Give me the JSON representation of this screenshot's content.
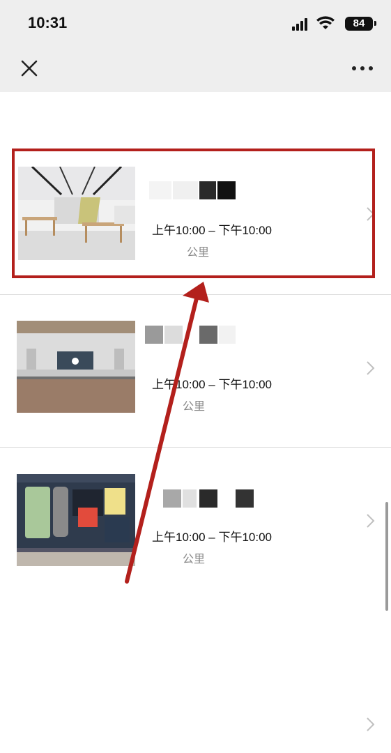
{
  "status_bar": {
    "time": "10:31",
    "battery": "84"
  },
  "nav": {
    "close_icon": "close-icon",
    "more_icon": "more-icon"
  },
  "stores": [
    {
      "hours": "上午10:00 – 下午10:00",
      "distance_unit": "公里"
    },
    {
      "hours": "上午10:00 – 下午10:00",
      "distance_unit": "公里"
    },
    {
      "hours": "上午10:00 – 下午10:00",
      "distance_unit": "公里"
    }
  ],
  "annotation": {
    "highlight_color": "#b3201c",
    "arrow_color": "#b3201c"
  },
  "colors": {
    "topbar_bg": "#eeeeee",
    "divider": "#dddddd",
    "text_secondary": "#888888"
  }
}
